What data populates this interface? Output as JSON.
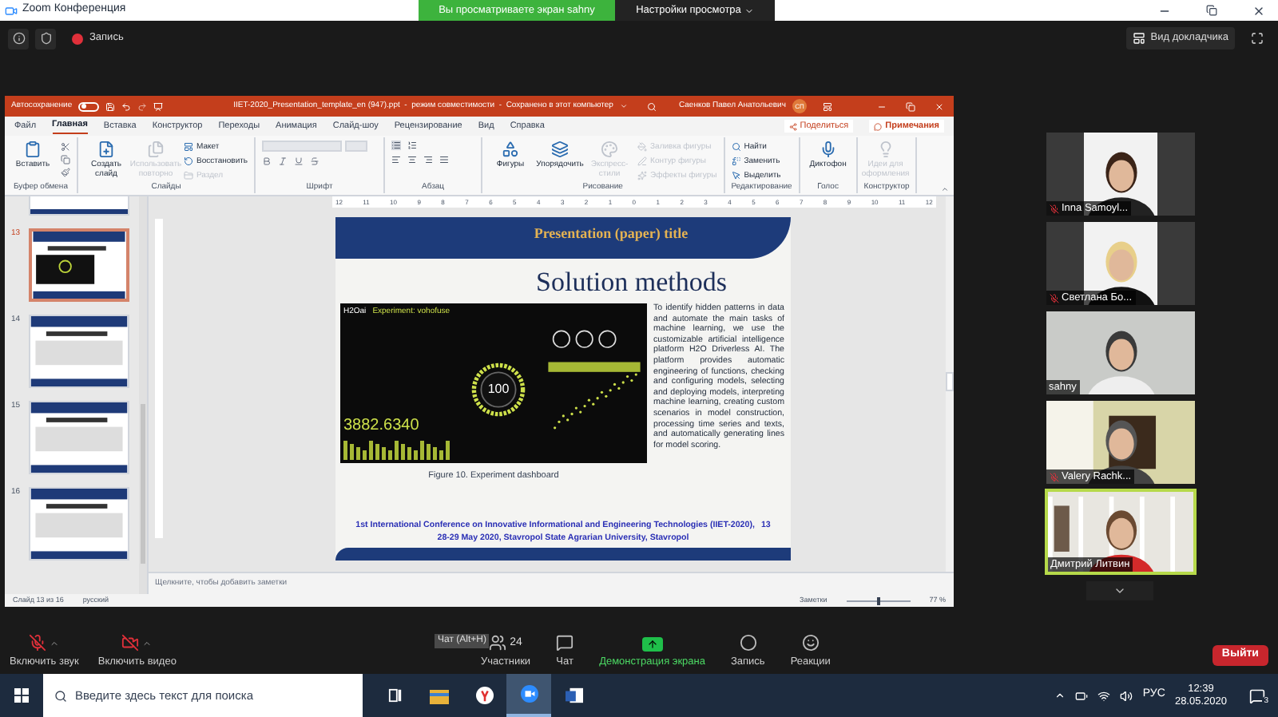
{
  "title_bar": {
    "title": "Zoom Конференция"
  },
  "share_banner": {
    "text": "Вы просматриваете экран sahny",
    "settings": "Настройки просмотра"
  },
  "top_toolbar": {
    "record": "Запись",
    "view": "Вид докладчика"
  },
  "ppt": {
    "autosave": {
      "label": "Автосохранение",
      "on": false
    },
    "file_title": "IIET-2020_Presentation_template_en (947).ppt  -  режим совместимости  -  Сохранено в этот компьютер",
    "user": "Саенков Павел Анатольевич",
    "avatar": "СП",
    "tabs": [
      {
        "label": "Файл",
        "selected": false
      },
      {
        "label": "Главная",
        "selected": true
      },
      {
        "label": "Вставка",
        "selected": false
      },
      {
        "label": "Конструктор",
        "selected": false
      },
      {
        "label": "Переходы",
        "selected": false
      },
      {
        "label": "Анимация",
        "selected": false
      },
      {
        "label": "Слайд-шоу",
        "selected": false
      },
      {
        "label": "Рецензирование",
        "selected": false
      },
      {
        "label": "Вид",
        "selected": false
      },
      {
        "label": "Справка",
        "selected": false
      }
    ],
    "share": "Поделиться",
    "comments": "Примечания",
    "ribbon_groups": [
      {
        "label": "Буфер обмена",
        "items": [
          {
            "kind": "large",
            "label": "Вставить",
            "disabled": false
          }
        ]
      },
      {
        "label": "Слайды",
        "items": [
          {
            "kind": "large",
            "label": "Создать слайд",
            "disabled": false
          },
          {
            "kind": "large",
            "label": "Использовать повторно",
            "disabled": true
          },
          {
            "kind": "small",
            "label": "Макет",
            "disabled": false
          },
          {
            "kind": "small",
            "label": "Восстановить",
            "disabled": false
          },
          {
            "kind": "small",
            "label": "Раздел",
            "disabled": true
          }
        ]
      },
      {
        "label": "Шрифт",
        "kind": "font"
      },
      {
        "label": "Абзац",
        "kind": "paragraph"
      },
      {
        "label": "Рисование",
        "items": [
          {
            "kind": "large",
            "label": "Фигуры",
            "disabled": false
          },
          {
            "kind": "large",
            "label": "Упорядочить",
            "disabled": false
          },
          {
            "kind": "large",
            "label": "Экспресс-стили",
            "disabled": true
          },
          {
            "kind": "small",
            "label": "Заливка фигуры",
            "disabled": true
          },
          {
            "kind": "small",
            "label": "Контур фигуры",
            "disabled": true
          },
          {
            "kind": "small",
            "label": "Эффекты фигуры",
            "disabled": true
          }
        ]
      },
      {
        "label": "Редактирование",
        "items": [
          {
            "kind": "small",
            "label": "Найти",
            "disabled": false
          },
          {
            "kind": "small",
            "label": "Заменить",
            "disabled": false
          },
          {
            "kind": "small",
            "label": "Выделить",
            "disabled": false
          }
        ]
      },
      {
        "label": "Голос",
        "items": [
          {
            "kind": "large",
            "label": "Диктофон",
            "disabled": false
          }
        ]
      },
      {
        "label": "Конструктор",
        "items": [
          {
            "kind": "large",
            "label": "Идеи для оформления",
            "disabled": true
          }
        ]
      }
    ],
    "ruler": [
      "12",
      "11",
      "10",
      "9",
      "8",
      "7",
      "6",
      "5",
      "4",
      "3",
      "2",
      "1",
      "0",
      "1",
      "2",
      "3",
      "4",
      "5",
      "6",
      "7",
      "8",
      "9",
      "10",
      "11",
      "12"
    ],
    "thumbnails": [
      {
        "number": "13",
        "selected": true
      },
      {
        "number": "14",
        "selected": false
      },
      {
        "number": "15",
        "selected": false
      },
      {
        "number": "16",
        "selected": false
      }
    ],
    "slide": {
      "header": "Presentation (paper) title",
      "title": "Solution methods",
      "dashboard": {
        "brand": "H2Oai",
        "experiment": "Experiment: vohofuse",
        "score": "100",
        "value": "3882.6340"
      },
      "paragraph": "To identify hidden patterns in data and automate the main tasks of machine learning, we use the customizable artificial intelligence platform H2O Driverless AI. The platform provides automatic engineering of functions, checking and configuring models, selecting and deploying models, interpreting machine learning, creating custom scenarios in model construction, processing time series and texts, and automatically generating lines for model scoring.",
      "caption": "Figure 10. Experiment dashboard",
      "footer_lines": [
        "1st International Conference on Innovative Informational and Engineering Technologies (IIET-2020),",
        "28-29 May 2020, Stavropol State Agrarian University, Stavropol"
      ],
      "page_number": "13"
    },
    "notes_placeholder": "Щелкните, чтобы добавить заметки",
    "status": {
      "slide": "Слайд 13 из 16",
      "language": "русский",
      "notes": "Заметки",
      "zoom": "77 %",
      "level": 0.5
    }
  },
  "participants": [
    {
      "name": "Inna Samoyl...",
      "muted": true,
      "active": false
    },
    {
      "name": "Светлана Бо...",
      "muted": true,
      "active": false
    },
    {
      "name": "sahny",
      "muted": false,
      "active": false
    },
    {
      "name": "Valery Rachk...",
      "muted": true,
      "active": false
    },
    {
      "name": "Дмитрий Литвин",
      "muted": false,
      "active": true
    }
  ],
  "bottom_toolbar": {
    "buttons": [
      {
        "kind": "mic",
        "label": "Включить звук"
      },
      {
        "kind": "video",
        "label": "Включить видео"
      },
      {
        "kind": "participants",
        "label": "Участники",
        "count": "24"
      },
      {
        "kind": "chat",
        "label": "Чат"
      },
      {
        "kind": "share",
        "label": "Демонстрация экрана"
      },
      {
        "kind": "record",
        "label": "Запись"
      },
      {
        "kind": "reactions",
        "label": "Реакции"
      }
    ],
    "tooltip": "Чат (Alt+H)",
    "leave": "Выйти"
  },
  "taskbar": {
    "search_placeholder": "Введите здесь текст для поиска",
    "apps": [
      {
        "kind": "taskview",
        "active": false
      },
      {
        "kind": "explorer",
        "active": false
      },
      {
        "kind": "browser",
        "active": false
      },
      {
        "kind": "zoom",
        "active": true
      },
      {
        "kind": "word",
        "active": false
      }
    ],
    "language": "РУС",
    "time": "12:39",
    "date": "28.05.2020",
    "notifications": "3"
  }
}
